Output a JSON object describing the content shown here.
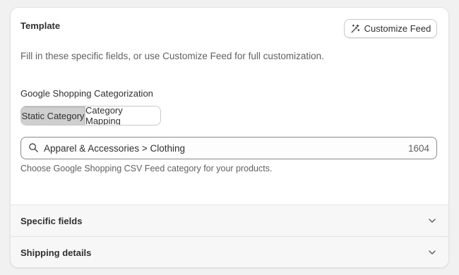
{
  "template": {
    "title": "Template",
    "customize_button_label": "Customize Feed",
    "description": "Fill in these specific fields, or use Customize Feed for full customization."
  },
  "categorization": {
    "label": "Google Shopping Categorization",
    "tabs": [
      "Static Category",
      "Category Mapping"
    ],
    "active_tab": "Static Category",
    "search_value": "Apparel & Accessories > Clothing",
    "category_code": "1604",
    "help_text": "Choose Google Shopping CSV Feed category for your products."
  },
  "sections": [
    {
      "title": "Specific fields"
    },
    {
      "title": "Shipping details"
    }
  ],
  "icons": {
    "customize": "magic-wand-icon",
    "search": "search-icon",
    "expand": "chevron-down-icon"
  },
  "colors": {
    "active_tab_bg": "#cfcfcf",
    "card_bg": "#ffffff",
    "accordion_bg": "#f7f7f7"
  }
}
